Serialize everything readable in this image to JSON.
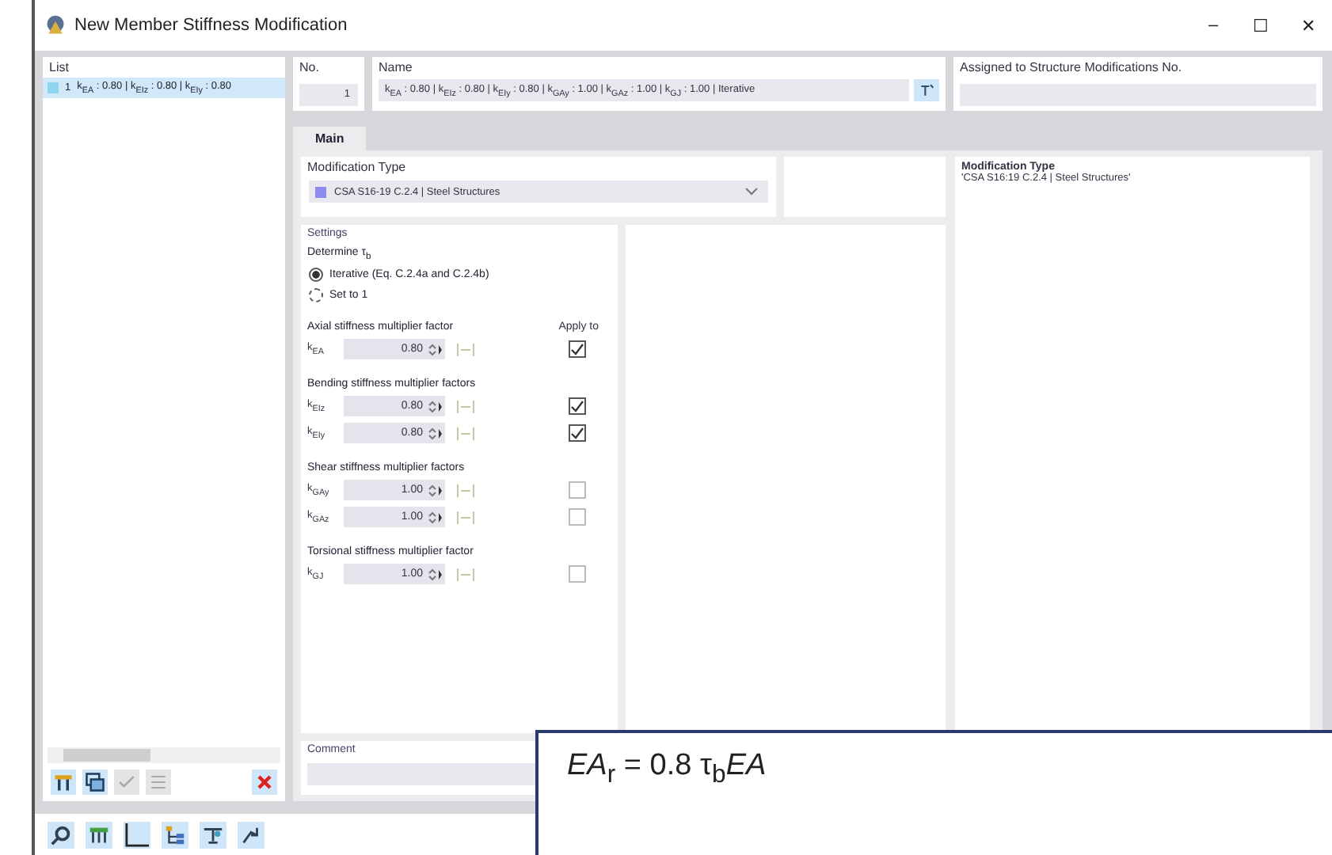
{
  "window": {
    "title": "New Member Stiffness Modification",
    "controls": [
      "–",
      "☐",
      "✕"
    ]
  },
  "list": {
    "heading": "List",
    "items": [
      {
        "number": "1",
        "label": "k$_{EA}$ : 0.80 | k$_{EIz}$ : 0.80 | k$_{EIy}$ : 0.80",
        "selected": true,
        "color": "#90d4f0"
      }
    ]
  },
  "number": {
    "label": "No.",
    "value": "1"
  },
  "name": {
    "label": "Name",
    "value": "k$_{EA}$ : 0.80 | k$_{EIz}$ : 0.80 | k$_{EIy}$ : 0.80 | k$_{GAy}$ : 1.00 | k$_{GAz}$ : 1.00 | k$_{GJ}$ : 1.00 | Iterative"
  },
  "assigned": {
    "label": "Assigned to Structure Modifications No."
  },
  "tabs": [
    {
      "label": "Main",
      "selected": true
    }
  ],
  "modification_type": {
    "label": "Modification Type",
    "value": "CSA S16-19 C.2.4 | Steel Structures",
    "color": "#8c8cf0"
  },
  "settings": {
    "title": "Settings",
    "determine_label": "Determine τ$_{b}$",
    "options": [
      {
        "label": "Iterative (Eq. C.2.4a and C.2.4b)",
        "selected": true
      },
      {
        "label": "Set to 1",
        "selected": false
      }
    ],
    "groups": [
      {
        "title": "Axial stiffness multiplier factor",
        "apply_label": "Apply to",
        "rows": [
          {
            "symbol": "k$_{EA}$",
            "value": "0.80",
            "checked": true
          }
        ]
      },
      {
        "title": "Bending stiffness multiplier factors",
        "rows": [
          {
            "symbol": "k$_{EIz}$",
            "value": "0.80",
            "checked": true
          },
          {
            "symbol": "k$_{EIy}$",
            "value": "0.80",
            "checked": true
          }
        ]
      },
      {
        "title": "Shear stiffness multiplier factors",
        "rows": [
          {
            "symbol": "k$_{GAy}$",
            "value": "1.00",
            "checked": false
          },
          {
            "symbol": "k$_{GAz}$",
            "value": "1.00",
            "checked": false
          }
        ]
      },
      {
        "title": "Torsional stiffness multiplier factor",
        "rows": [
          {
            "symbol": "k$_{GJ}$",
            "value": "1.00",
            "checked": false
          }
        ]
      }
    ]
  },
  "description": {
    "title": "Modification Type",
    "text": "'CSA S16:19 C.2.4 | Steel Structures'"
  },
  "comment": {
    "label": "Comment"
  },
  "formulas": [
    "*EA*$_{r}$ = 0.8 τ$_{b}$*EA*"
  ]
}
